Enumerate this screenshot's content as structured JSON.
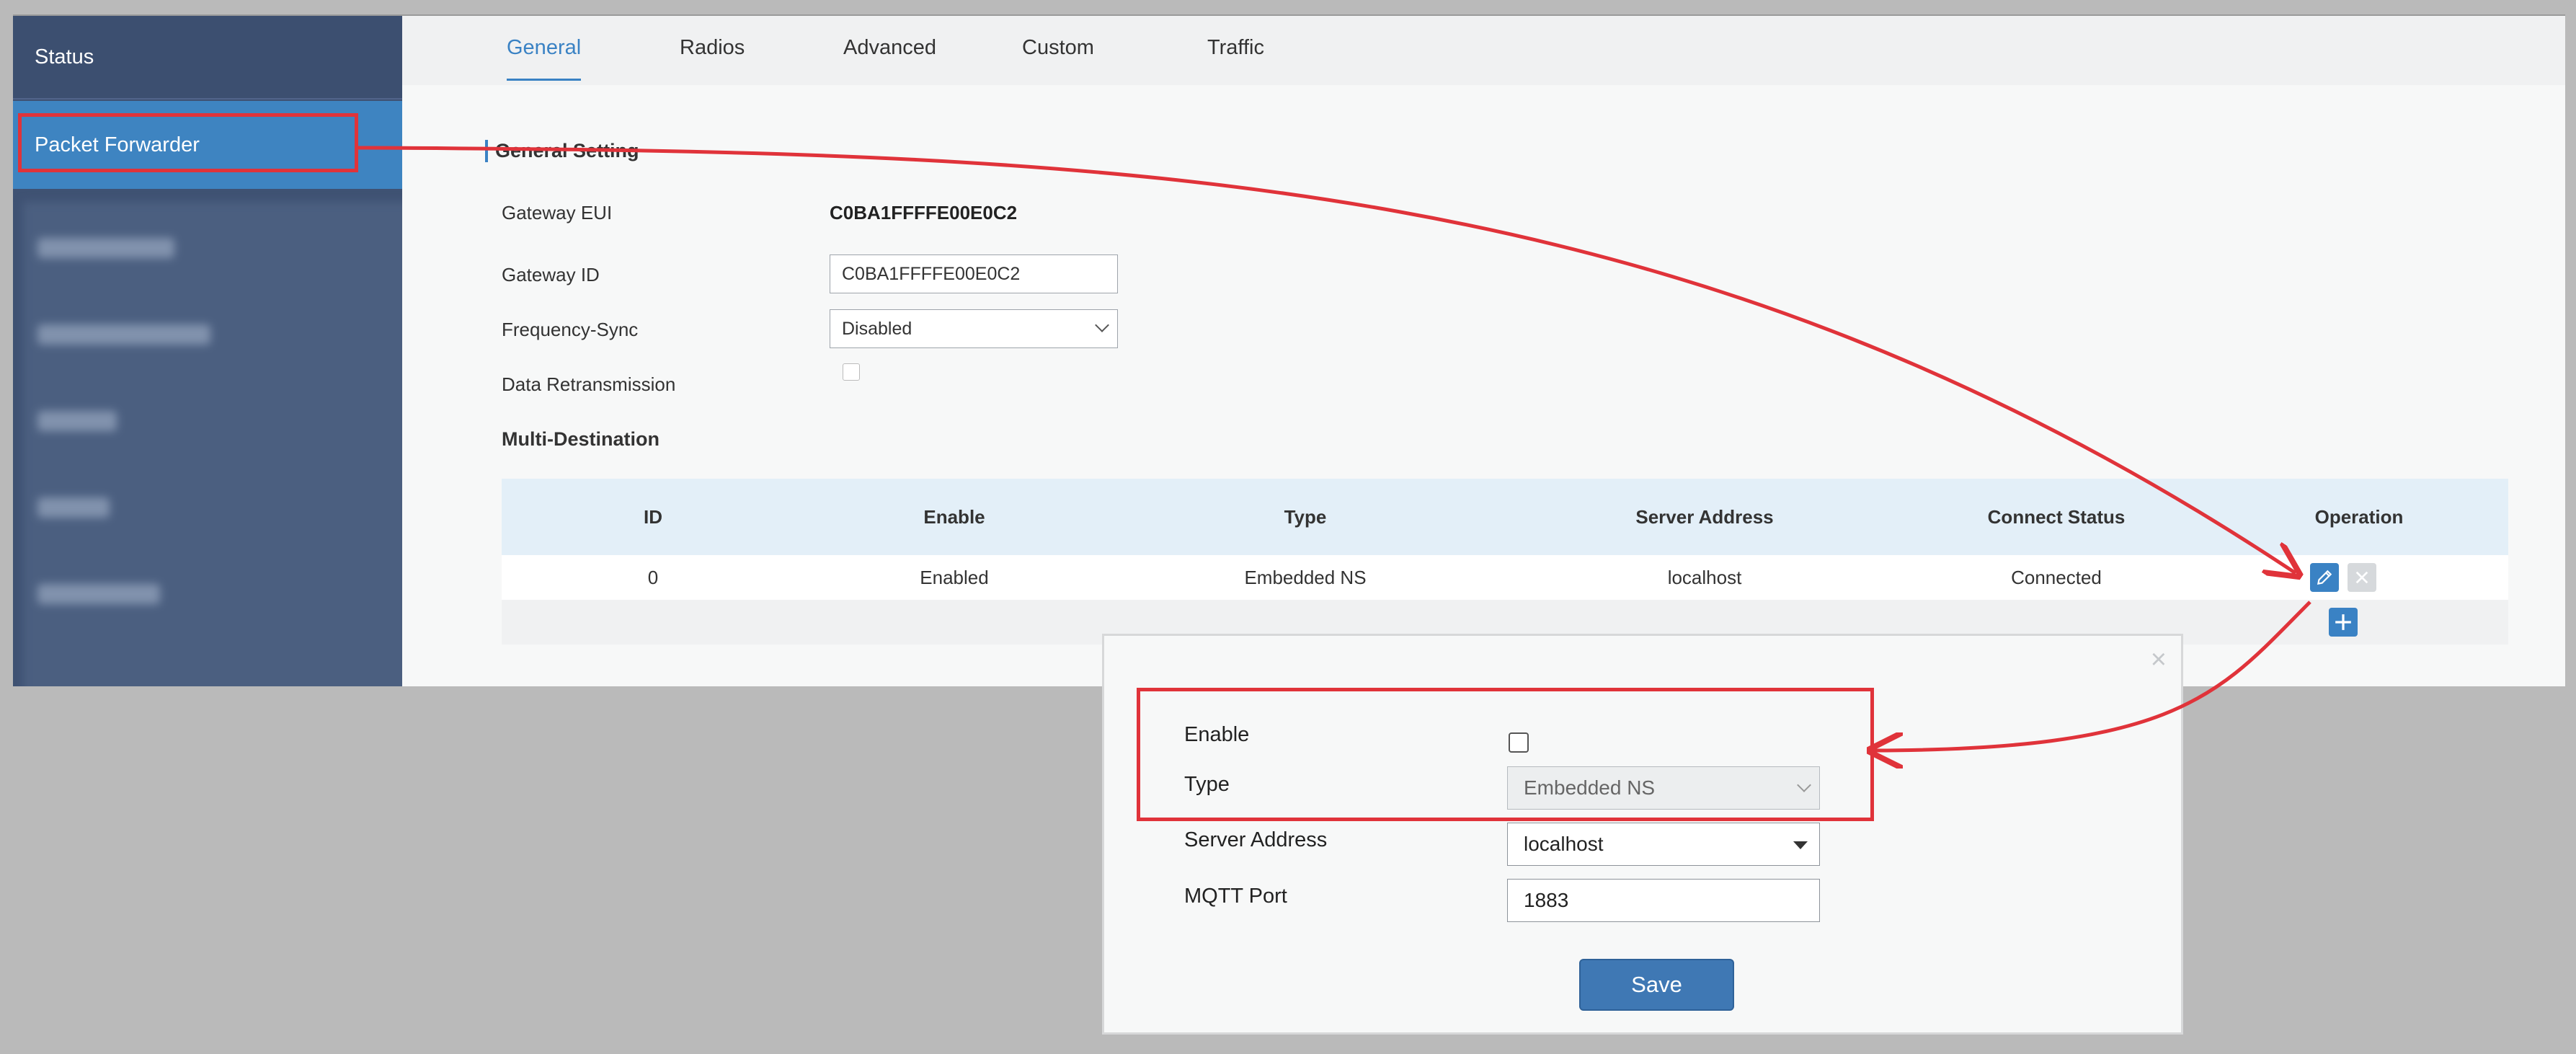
{
  "sidebar": {
    "status_label": "Status",
    "packet_forwarder_label": "Packet Forwarder"
  },
  "tabs": [
    "General",
    "Radios",
    "Advanced",
    "Custom",
    "Traffic"
  ],
  "general": {
    "section_title": "General Setting",
    "gateway_eui_label": "Gateway EUI",
    "gateway_eui_value": "C0BA1FFFFE00E0C2",
    "gateway_id_label": "Gateway ID",
    "gateway_id_value": "C0BA1FFFFE00E0C2",
    "frequency_sync_label": "Frequency-Sync",
    "frequency_sync_value": "Disabled",
    "data_retransmission_label": "Data Retransmission",
    "data_retransmission_checked": false
  },
  "multi_destination": {
    "section_title": "Multi-Destination",
    "columns": [
      "ID",
      "Enable",
      "Type",
      "Server Address",
      "Connect Status",
      "Operation"
    ],
    "rows": [
      {
        "id": "0",
        "enable": "Enabled",
        "type": "Embedded NS",
        "server_address": "localhost",
        "connect_status": "Connected"
      }
    ]
  },
  "modal": {
    "close_icon": "×",
    "enable_label": "Enable",
    "enable_checked": false,
    "type_label": "Type",
    "type_value": "Embedded NS",
    "server_address_label": "Server Address",
    "server_address_value": "localhost",
    "mqtt_port_label": "MQTT Port",
    "mqtt_port_value": "1883",
    "save_label": "Save"
  },
  "colors": {
    "sidebar": "#3f5273",
    "sidebar_active": "#3e84c1",
    "accent": "#3a82c4",
    "annotation_red": "#e0333a"
  }
}
